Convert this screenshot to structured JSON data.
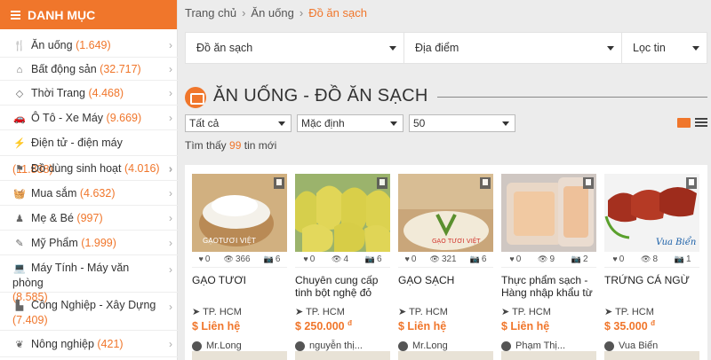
{
  "sidebar": {
    "title": "DANH MỤC",
    "items": [
      {
        "label": "Ăn uống",
        "count": "(1.649)",
        "icon": "utensils-icon"
      },
      {
        "label": "Bất động sản",
        "count": "(32.717)",
        "icon": "home-icon"
      },
      {
        "label": "Thời Trang",
        "count": "(4.468)",
        "icon": "diamond-icon"
      },
      {
        "label": "Ô Tô - Xe Máy",
        "count": "(9.669)",
        "icon": "car-icon"
      },
      {
        "label": "Điện tử - điện máy",
        "count": "(11.838)",
        "icon": "plug-icon"
      },
      {
        "label": "Đồ dùng sinh hoạt",
        "count": "(4.016)",
        "icon": "household-icon"
      },
      {
        "label": "Mua sắm",
        "count": "(4.632)",
        "icon": "shopping-basket-icon"
      },
      {
        "label": "Mẹ & Bé",
        "count": "(997)",
        "icon": "child-icon"
      },
      {
        "label": "Mỹ Phẩm",
        "count": "(1.999)",
        "icon": "cosmetics-icon"
      },
      {
        "label": "Máy Tính - Máy văn phòng",
        "count": "8.585)",
        "count_open": "(",
        "icon": "laptop-icon"
      },
      {
        "label": "Công Nghiệp - Xây Dựng",
        "count": "7.409)",
        "count_open": "(",
        "icon": "industry-icon"
      },
      {
        "label": "Nông nghiệp",
        "count": "(421)",
        "icon": "sprout-icon"
      }
    ]
  },
  "breadcrumb": [
    "Trang chủ",
    "Ăn uống",
    "Đồ ăn sạch"
  ],
  "filters": {
    "category": "Đồ ăn sạch",
    "location": "Địa điểm",
    "filter": "Lọc tin"
  },
  "page_title": "ĂN UỐNG - ĐỒ ĂN SẠCH",
  "sort": {
    "type": "Tất cả",
    "order": "Mặc định",
    "per_page": "50"
  },
  "found": {
    "prefix": "Tìm thấy",
    "count": "99",
    "suffix": "tin mới"
  },
  "listings": [
    {
      "name": "GẠO TƯƠI",
      "likes": "0",
      "views": "366",
      "photos": "6",
      "location": "TP. HCM",
      "price": "$ Liên hệ",
      "price_suffix": "",
      "user": "Mr.Long",
      "image": "rice-bowl"
    },
    {
      "name": "Chuyên cung cấp tinh bột nghệ đỏ",
      "likes": "0",
      "views": "4",
      "photos": "6",
      "location": "TP. HCM",
      "price": "$ 250.000",
      "price_suffix": "đ",
      "user": "nguyễn thị...",
      "image": "turmeric-bags"
    },
    {
      "name": "GẠO SẠCH",
      "likes": "0",
      "views": "321",
      "photos": "6",
      "location": "TP. HCM",
      "price": "$ Liên hệ",
      "price_suffix": "",
      "user": "Mr.Long",
      "image": "rice-grain"
    },
    {
      "name": "Thực phẩm sạch - Hàng nhập khẩu từ",
      "likes": "0",
      "views": "9",
      "photos": "2",
      "location": "TP. HCM",
      "price": "$ Liên hệ",
      "price_suffix": "",
      "user": "Phạm Thị...",
      "image": "meat-pack"
    },
    {
      "name": "TRỨNG CÁ NGỪ",
      "likes": "0",
      "views": "8",
      "photos": "1",
      "location": "TP. HCM",
      "price": "$ 35.000",
      "price_suffix": "đ",
      "user": "Vua Biển",
      "image": "fish-roe"
    }
  ],
  "image_texts": {
    "rice_bowl": "GẠOTƯƠI VIỆT",
    "rice_grain": "GẠO TƯƠI VIỆT",
    "fish_roe": "Vua Biển"
  },
  "colors": {
    "accent": "#f0762b"
  }
}
